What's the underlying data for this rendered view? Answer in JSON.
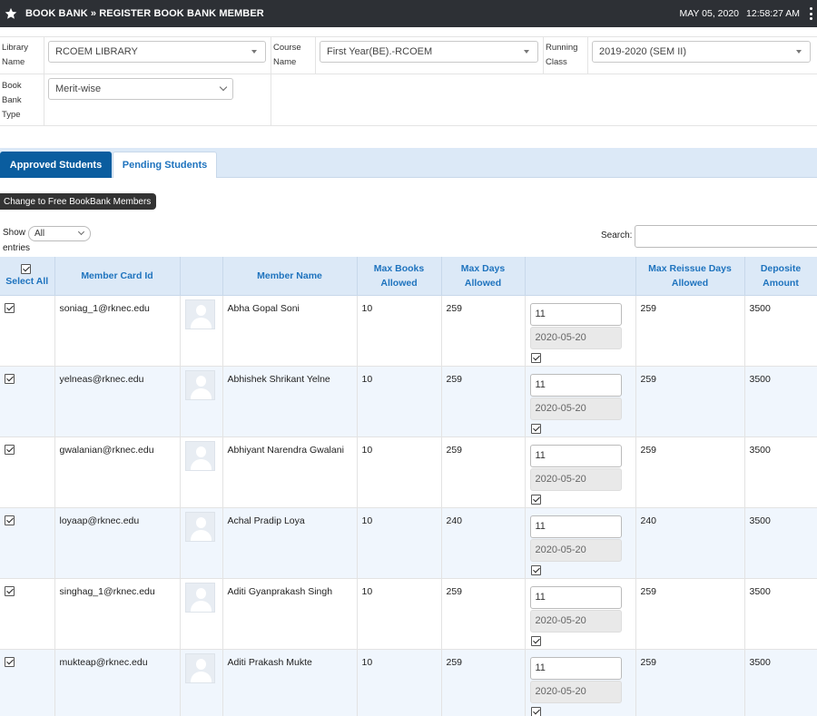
{
  "header": {
    "title": "BOOK BANK » REGISTER BOOK BANK MEMBER",
    "date": "MAY 05, 2020",
    "time": "12:58:27 AM"
  },
  "filters": {
    "library_label": "Library Name",
    "library_value": "RCOEM LIBRARY",
    "course_label": "Course Name",
    "course_value": "First Year(BE).-RCOEM",
    "class_label": "Running Class",
    "class_value": "2019-2020 (SEM II)",
    "type_label": "Book Bank Type",
    "type_value": "Merit-wise"
  },
  "tabs": [
    {
      "label": "Approved Students",
      "active": true
    },
    {
      "label": "Pending Students",
      "active": false
    }
  ],
  "change_button": "Change to Free BookBank Members",
  "table_controls": {
    "show_label": "Show",
    "show_value": "All",
    "entries_label": "entries",
    "search_label": "Search:"
  },
  "columns": {
    "select_all": "Select All",
    "member_card_id": "Member Card Id",
    "photo": "",
    "member_name": "Member Name",
    "max_books": "Max Books Allowed",
    "max_days": "Max Days Allowed",
    "reissue": "",
    "max_reissue_days": "Max Reissue Days Allowed",
    "deposit": "Deposite Amount"
  },
  "rows": [
    {
      "card_id": "soniag_1@rknec.edu",
      "name": "Abha Gopal Soni",
      "max_books": "10",
      "max_days": "259",
      "reissue_value": "11",
      "reissue_date": "2020-05-20",
      "max_reissue_days": "259",
      "deposit": "3500"
    },
    {
      "card_id": "yelneas@rknec.edu",
      "name": "Abhishek Shrikant Yelne",
      "max_books": "10",
      "max_days": "259",
      "reissue_value": "11",
      "reissue_date": "2020-05-20",
      "max_reissue_days": "259",
      "deposit": "3500"
    },
    {
      "card_id": "gwalanian@rknec.edu",
      "name": "Abhiyant Narendra Gwalani",
      "max_books": "10",
      "max_days": "259",
      "reissue_value": "11",
      "reissue_date": "2020-05-20",
      "max_reissue_days": "259",
      "deposit": "3500"
    },
    {
      "card_id": "loyaap@rknec.edu",
      "name": "Achal Pradip Loya",
      "max_books": "10",
      "max_days": "240",
      "reissue_value": "11",
      "reissue_date": "2020-05-20",
      "max_reissue_days": "240",
      "deposit": "3500"
    },
    {
      "card_id": "singhag_1@rknec.edu",
      "name": "Aditi Gyanprakash Singh",
      "max_books": "10",
      "max_days": "259",
      "reissue_value": "11",
      "reissue_date": "2020-05-20",
      "max_reissue_days": "259",
      "deposit": "3500"
    },
    {
      "card_id": "mukteap@rknec.edu",
      "name": "Aditi Prakash Mukte",
      "max_books": "10",
      "max_days": "259",
      "reissue_value": "11",
      "reissue_date": "2020-05-20",
      "max_reissue_days": "259",
      "deposit": "3500"
    }
  ]
}
